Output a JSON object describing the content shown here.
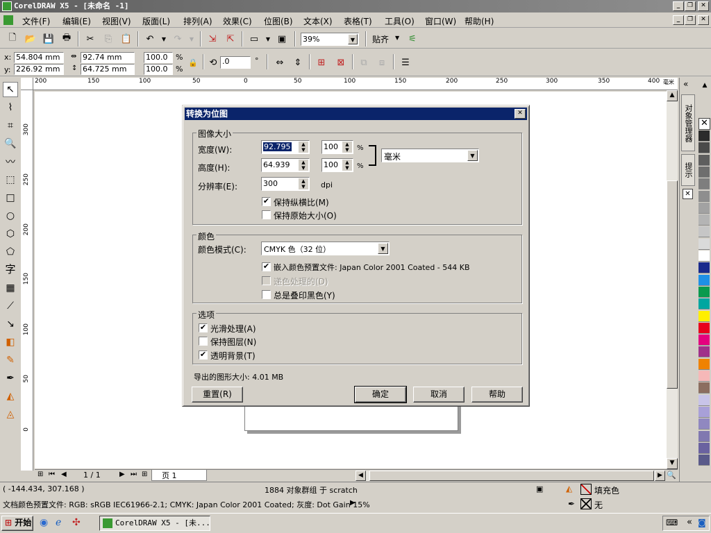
{
  "app": {
    "title": "CorelDRAW X5 - [未命名 -1]"
  },
  "menu": [
    "文件(F)",
    "编辑(E)",
    "视图(V)",
    "版面(L)",
    "排列(A)",
    "效果(C)",
    "位图(B)",
    "文本(X)",
    "表格(T)",
    "工具(O)",
    "窗口(W)",
    "帮助(H)"
  ],
  "toolbar": {
    "zoom": "39%",
    "snap": "贴齐"
  },
  "propbar": {
    "x": "54.804 mm",
    "y": "226.92 mm",
    "w": "92.74 mm",
    "h": "64.725 mm",
    "sx": "100.0",
    "sy": "100.0",
    "pct": "%",
    "rot": ".0",
    "deg": "°"
  },
  "ruler": {
    "h_ticks": [
      "200",
      "150",
      "100",
      "50",
      "0",
      "50",
      "100",
      "150",
      "200",
      "250",
      "300",
      "350",
      "400"
    ],
    "h_unit": "毫米",
    "v_ticks": [
      "300",
      "250",
      "200",
      "150",
      "100",
      "50",
      "0"
    ]
  },
  "dialog": {
    "title": "转换为位图",
    "size_group": "图像大小",
    "width_label": "宽度(W):",
    "width_value": "92.795",
    "width_pct": "100",
    "height_label": "高度(H):",
    "height_value": "64.939",
    "height_pct": "100",
    "res_label": "分辨率(E):",
    "res_value": "300",
    "res_unit": "dpi",
    "pct_sym": "%",
    "unit": "毫米",
    "keep_ratio": "保持纵横比(M)",
    "keep_size": "保持原始大小(O)",
    "color_group": "颜色",
    "color_mode_label": "颜色模式(C):",
    "color_mode": "CMYK 色（32 位）",
    "embed": "嵌入颜色预置文件: Japan Color 2001 Coated - 544 KB",
    "dither": "递色处理的(D)",
    "overprint": "总是叠印黑色(Y)",
    "options_group": "选项",
    "smooth": "光滑处理(A)",
    "keep_layers": "保持图层(N)",
    "transparent": "透明背景(T)",
    "export_size": "导出的图形大小: 4.01 MB",
    "reset": "重置(R)",
    "ok": "确定",
    "cancel": "取消",
    "help": "帮助"
  },
  "docker": {
    "tab1": "对象管理器",
    "tab2": "提示"
  },
  "page_nav": {
    "page": "1 / 1",
    "tab": "页 1"
  },
  "status": {
    "coords": "( -144.434, 307.168 )",
    "selection": "1884 对象群组 于 scratch",
    "fill": "填充色",
    "outline": "无",
    "profile": "文档颜色预置文件: RGB: sRGB IEC61966-2.1; CMYK: Japan Color 2001 Coated; 灰度: Dot Gain 15%"
  },
  "taskbar": {
    "start": "开始",
    "task": "CorelDRAW X5 - [未..."
  },
  "palette": [
    "#2b2b2b",
    "#4a4a4a",
    "#5e5e5e",
    "#6e6e6e",
    "#7e7e7e",
    "#8e8e8e",
    "#a2a2a2",
    "#b4b4b4",
    "#c6c6c6",
    "#dadada",
    "#ffffff",
    "#1a2a8c",
    "#1e90e6",
    "#0a9a4e",
    "#00a6a0",
    "#ffef00",
    "#e8001c",
    "#e4007f",
    "#a0308a",
    "#ef8200",
    "#f6b8b8",
    "#8c6e60",
    "#c8c4e8",
    "#a8a0d8",
    "#9088c0",
    "#8078b0",
    "#6a62a0",
    "#5a5a8a"
  ]
}
